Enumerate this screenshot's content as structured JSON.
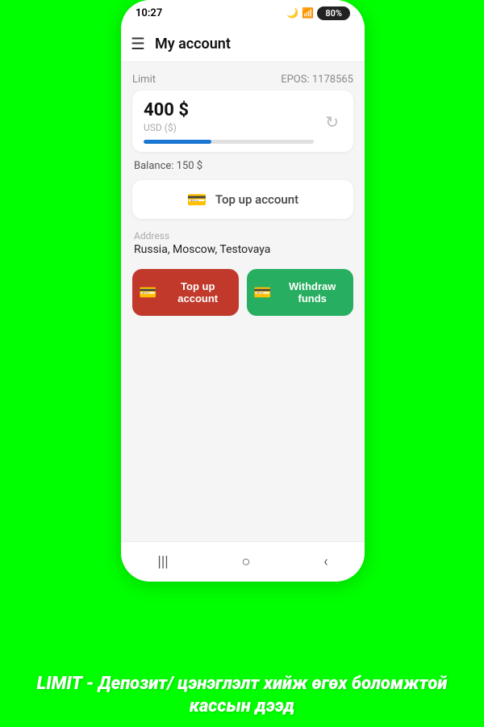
{
  "statusBar": {
    "time": "10:27",
    "battery": "80%",
    "batteryLabel": "80%"
  },
  "header": {
    "title": "My account",
    "menuIcon": "☰"
  },
  "account": {
    "limitLabel": "Limit",
    "eposLabel": "EPOS: 1178565",
    "amount": "400 $",
    "currency": "USD ($)",
    "progressPercent": 40,
    "balanceText": "Balance: 150 $",
    "topupButtonLabel": "Top up account",
    "address": {
      "label": "Address",
      "value": "Russia, Moscow, Testovaya"
    }
  },
  "actions": {
    "topupLabel": "Top up account",
    "withdrawLabel": "Withdraw funds"
  },
  "nav": {
    "back": "‹",
    "home": "○",
    "recent": "|||"
  },
  "caption": "LIMIT - Депозит/ цэнэглэлт хийж өгөх боломжтой кассын дээд"
}
